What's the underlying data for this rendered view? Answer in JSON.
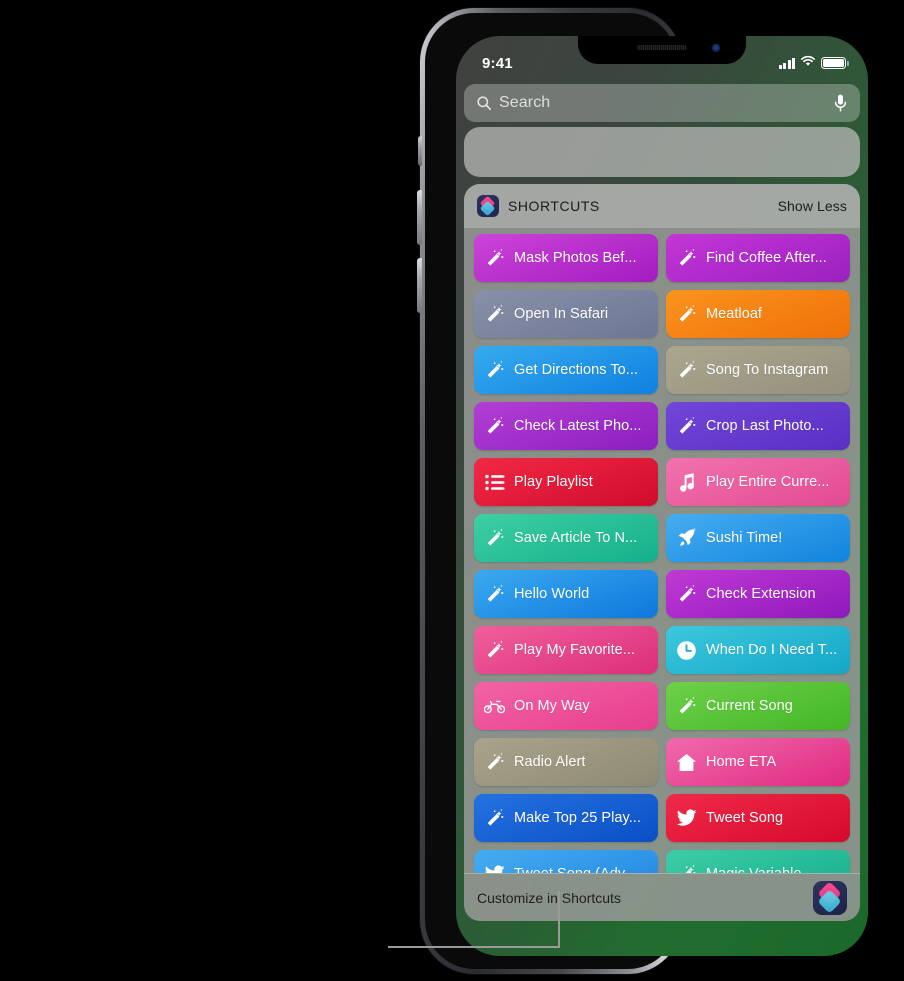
{
  "status_bar": {
    "time": "9:41",
    "signal_icon": "cellular-signal-icon",
    "wifi_icon": "wifi-icon",
    "battery_icon": "battery-icon"
  },
  "search": {
    "placeholder": "Search",
    "search_icon": "search-icon",
    "mic_icon": "microphone-icon"
  },
  "widget": {
    "app_icon": "shortcuts-app-icon",
    "title": "SHORTCUTS",
    "show_less_label": "Show Less",
    "footer_label": "Customize in Shortcuts",
    "footer_icon": "shortcuts-app-icon"
  },
  "colors": {
    "magenta": "#c22fd0",
    "purple_violet": "#8a3fd4",
    "slate_gray": "#7e86a3",
    "orange": "#f28118",
    "blue": "#2a9ae8",
    "khaki": "#a09b86",
    "red": "#e8243f",
    "pink_music": "#ea5f9e",
    "teal_green": "#2fbf9a",
    "sky_blue": "#2f9fe8",
    "hot_pink": "#ec4d8e",
    "cyan": "#2bb8cf",
    "green": "#59c33b",
    "pink_rose": "#ec55a0",
    "deep_blue": "#1560cf",
    "crimson": "#e3203c"
  },
  "shortcuts": [
    {
      "label": "Mask Photos Bef...",
      "icon": "magic-wand-icon",
      "c1": "#cc44d8",
      "c2": "#a41cc0"
    },
    {
      "label": "Find Coffee After...",
      "icon": "magic-wand-icon",
      "c1": "#c436d6",
      "c2": "#9b21bf"
    },
    {
      "label": "Open In Safari",
      "icon": "magic-wand-icon",
      "c1": "#8990a8",
      "c2": "#6d7795"
    },
    {
      "label": "Meatloaf",
      "icon": "magic-wand-icon",
      "c1": "#fa931f",
      "c2": "#ef7108"
    },
    {
      "label": "Get Directions To...",
      "icon": "magic-wand-icon",
      "c1": "#35abee",
      "c2": "#1180e0"
    },
    {
      "label": "Song To Instagram",
      "icon": "magic-wand-icon",
      "c1": "#aaa68f",
      "c2": "#95907b"
    },
    {
      "label": "Check Latest Pho...",
      "icon": "magic-wand-icon",
      "c1": "#b43ed4",
      "c2": "#8b1fc0"
    },
    {
      "label": "Crop Last Photo...",
      "icon": "magic-wand-icon",
      "c1": "#7146d8",
      "c2": "#5a2fc4"
    },
    {
      "label": "Play Playlist",
      "icon": "list-icon",
      "c1": "#f02a45",
      "c2": "#d10b2c"
    },
    {
      "label": "Play Entire Curre...",
      "icon": "music-note-icon",
      "c1": "#f272ad",
      "c2": "#e24a92"
    },
    {
      "label": "Save Article To N...",
      "icon": "magic-wand-icon",
      "c1": "#3ecfa3",
      "c2": "#14b08b"
    },
    {
      "label": "Sushi Time!",
      "icon": "rocket-icon",
      "c1": "#46adf0",
      "c2": "#1184dd"
    },
    {
      "label": "Hello World",
      "icon": "magic-wand-icon",
      "c1": "#3aaaef",
      "c2": "#0f78dc"
    },
    {
      "label": "Check Extension",
      "icon": "magic-wand-icon",
      "c1": "#c03ad4",
      "c2": "#8f18bd"
    },
    {
      "label": "Play My Favorite...",
      "icon": "magic-wand-icon",
      "c1": "#f05f9c",
      "c2": "#dc2f79"
    },
    {
      "label": "When Do I Need T...",
      "icon": "clock-icon",
      "c1": "#3cc8dc",
      "c2": "#14a7c8"
    },
    {
      "label": "On My Way",
      "icon": "motorcycle-icon",
      "c1": "#f263a4",
      "c2": "#e73e8e"
    },
    {
      "label": "Current Song",
      "icon": "magic-wand-icon",
      "c1": "#6ed04a",
      "c2": "#43b726"
    },
    {
      "label": "Radio Alert",
      "icon": "magic-wand-icon",
      "c1": "#a9a38c",
      "c2": "#8f8a73"
    },
    {
      "label": "Home ETA",
      "icon": "home-icon",
      "c1": "#f06aad",
      "c2": "#e02a80"
    },
    {
      "label": "Make Top 25 Play...",
      "icon": "magic-wand-icon",
      "c1": "#2472e0",
      "c2": "#0b4fc6"
    },
    {
      "label": "Tweet Song",
      "icon": "twitter-bird-icon",
      "c1": "#f02a49",
      "c2": "#d60a2c"
    },
    {
      "label": "Tweet Song (Adv...",
      "icon": "twitter-bird-icon",
      "c1": "#46acf0",
      "c2": "#1f86e2"
    },
    {
      "label": "Magic Variable",
      "icon": "magic-wand-icon",
      "c1": "#3ecda5",
      "c2": "#13ae8d"
    }
  ]
}
